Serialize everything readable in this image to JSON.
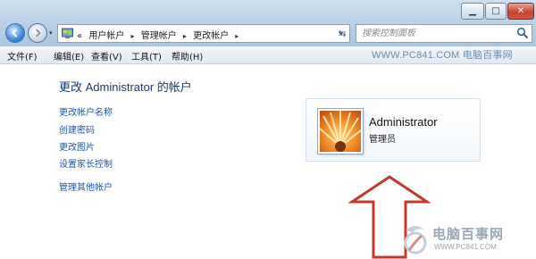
{
  "window": {
    "controls": {
      "minimize": "▁",
      "maximize": "□",
      "close": "✕"
    }
  },
  "nav": {
    "back_icon": "arrow-left-icon",
    "forward_icon": "arrow-right-icon",
    "dropdown": "▾"
  },
  "address": {
    "prefix": "«",
    "crumbs": [
      "用户帐户",
      "管理帐户",
      "更改帐户"
    ],
    "separator": "▸",
    "dropdown": "▾",
    "refresh": "⇆"
  },
  "search": {
    "placeholder": "搜索控制面板"
  },
  "menu": {
    "items": [
      "文件(F)",
      "编辑(E)",
      "查看(V)",
      "工具(T)",
      "帮助(H)"
    ]
  },
  "watermark": "WWW.PC841.COM 电脑百事网",
  "content": {
    "title": "更改 Administrator 的帐户",
    "links": [
      "更改帐户名称",
      "创建密码",
      "更改图片",
      "设置家长控制",
      "管理其他帐户"
    ]
  },
  "user_card": {
    "name": "Administrator",
    "role": "管理员"
  },
  "brand": {
    "name": "电脑百事网",
    "url": "WWW.PC841.COM"
  },
  "colors": {
    "link": "#1c56a4",
    "title": "#1a3c6e",
    "arrow": "#c0392b",
    "frame": "#bcd3e8"
  }
}
